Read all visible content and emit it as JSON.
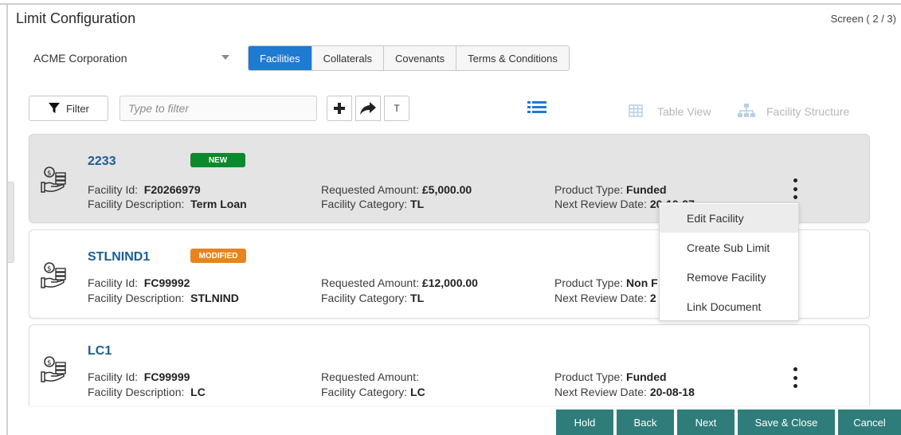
{
  "page": {
    "title": "Limit Configuration",
    "screen_indicator": "Screen ( 2 / 3)"
  },
  "customer_select": {
    "value": "ACME Corporation"
  },
  "tabs": [
    {
      "label": "Facilities",
      "active": true
    },
    {
      "label": "Collaterals",
      "active": false
    },
    {
      "label": "Covenants",
      "active": false
    },
    {
      "label": "Terms & Conditions",
      "active": false
    }
  ],
  "toolbar": {
    "filter_label": "Filter",
    "filter_placeholder": "Type to filter",
    "text_tool_label": "T",
    "table_view_label": "Table View",
    "facility_structure_label": "Facility Structure"
  },
  "facilities": [
    {
      "name": "2233",
      "badge": "NEW",
      "facility_id_label": "Facility Id:",
      "facility_id": "F20266979",
      "facility_description_label": "Facility Description:",
      "facility_description": "Term Loan",
      "requested_amount_label": "Requested Amount:",
      "requested_amount": "£5,000.00",
      "facility_category_label": "Facility Category:",
      "facility_category": "TL",
      "product_type_label": "Product Type:",
      "product_type": "Funded",
      "next_review_date_label": "Next Review Date:",
      "next_review_date": "20-10-27"
    },
    {
      "name": "STLNIND1",
      "badge": "MODIFIED",
      "facility_id_label": "Facility Id:",
      "facility_id": "FC99992",
      "facility_description_label": "Facility Description:",
      "facility_description": "STLNIND",
      "requested_amount_label": "Requested Amount:",
      "requested_amount": "£12,000.00",
      "facility_category_label": "Facility Category:",
      "facility_category": "TL",
      "product_type_label": "Product Type:",
      "product_type": "Non F",
      "next_review_date_label": "Next Review Date:",
      "next_review_date": "2"
    },
    {
      "name": "LC1",
      "badge": "",
      "facility_id_label": "Facility Id:",
      "facility_id": "FC99999",
      "facility_description_label": "Facility Description:",
      "facility_description": "LC",
      "requested_amount_label": "Requested Amount:",
      "requested_amount": "",
      "facility_category_label": "Facility Category:",
      "facility_category": "LC",
      "product_type_label": "Product Type:",
      "product_type": "Funded",
      "next_review_date_label": "Next Review Date:",
      "next_review_date": "20-08-18"
    }
  ],
  "context_menu": [
    {
      "label": "Edit Facility",
      "highlighted": true
    },
    {
      "label": "Create Sub Limit",
      "highlighted": false
    },
    {
      "label": "Remove Facility",
      "highlighted": false
    },
    {
      "label": "Link Document",
      "highlighted": false
    }
  ],
  "footer": {
    "hold": "Hold",
    "back": "Back",
    "next": "Next",
    "save_close": "Save & Close",
    "cancel": "Cancel"
  },
  "colors": {
    "accent_blue": "#1f7ad1",
    "link_blue": "#1b5d96",
    "badge_new": "#0a8a2d",
    "badge_modified": "#e8841e",
    "footer_teal": "#2e7d7a"
  }
}
